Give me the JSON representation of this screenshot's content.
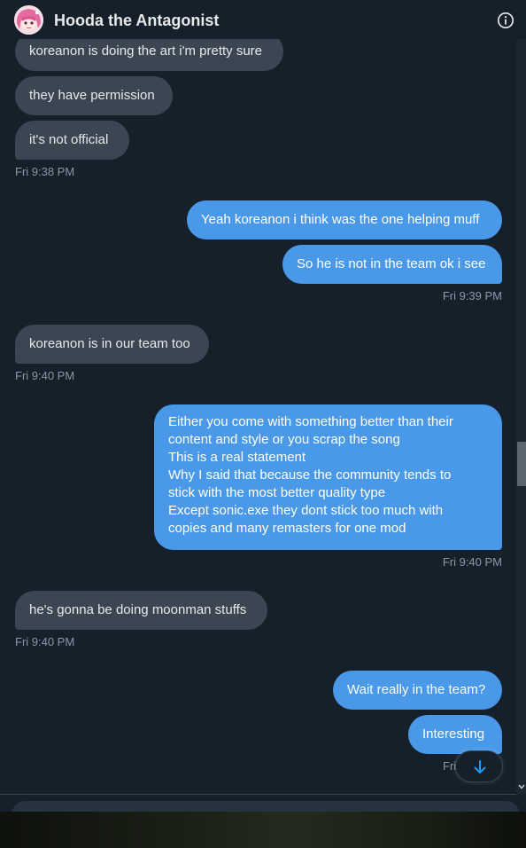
{
  "header": {
    "title": "Hooda the Antagonist",
    "avatar_icon": "anime-avatar",
    "info_icon": "info-circle-icon"
  },
  "messages": [
    {
      "dir": "in",
      "text": "koreanon is doing the art i'm pretty sure"
    },
    {
      "dir": "in",
      "text": "they have permission"
    },
    {
      "dir": "in",
      "text": "it's not official"
    },
    {
      "ts": "Fri 9:38 PM"
    },
    {
      "dir": "out",
      "text": "Yeah koreanon i think was the one helping muff"
    },
    {
      "dir": "out",
      "text": "So he is not in the team ok i see"
    },
    {
      "ts": "Fri 9:39 PM"
    },
    {
      "dir": "in",
      "text": "koreanon is in our team too"
    },
    {
      "ts": "Fri 9:40 PM"
    },
    {
      "dir": "out",
      "lines": [
        "Either you come with something better than their",
        "content and style or you scrap the song",
        "This is a real statement",
        "Why I said that because the community tends to",
        "stick with the most better quality type",
        "Except sonic.exe they dont stick too much with",
        "copies and many remasters for one mod"
      ]
    },
    {
      "ts": "Fri 9:40 PM"
    },
    {
      "dir": "in",
      "text": "he's gonna be doing moonman stuffs"
    },
    {
      "ts": "Fri 9:40 PM"
    },
    {
      "dir": "out",
      "text": "Wait really in the team?"
    },
    {
      "dir": "out",
      "text": "Interesting"
    },
    {
      "ts": "Fri"
    }
  ],
  "scroll_down_icon": "arrow-down-icon",
  "colors": {
    "background": "#15202b",
    "incoming_bubble": "#3b4652",
    "outgoing_bubble": "#4a99e9",
    "timestamp": "#8b98a5",
    "accent": "#1d9bf0"
  }
}
